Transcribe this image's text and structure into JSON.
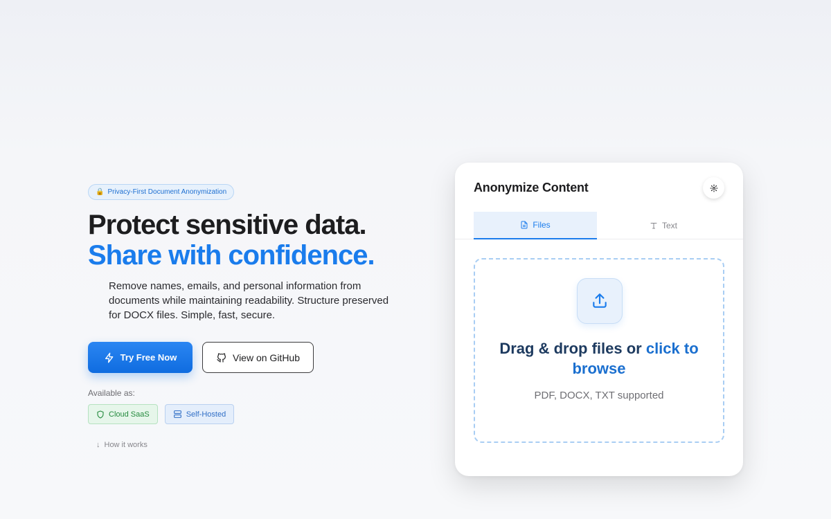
{
  "hero": {
    "badge_icon": "lock-icon",
    "badge_text": "Privacy-First Document Anonymization",
    "headline_line1": "Protect sensitive data.",
    "headline_line2": "Share with confidence.",
    "description": "Remove names, emails, and personal information from documents while maintaining readability. Structure preserved for DOCX files. Simple, fast, secure.",
    "primary_button": "Try Free Now",
    "secondary_button": "View on GitHub",
    "available_label": "Available as:",
    "chips": [
      {
        "label": "Cloud SaaS",
        "icon": "shield-icon"
      },
      {
        "label": "Self-Hosted",
        "icon": "server-icon"
      }
    ],
    "how_it_works": "How it works"
  },
  "card": {
    "title": "Anonymize Content",
    "tabs": [
      {
        "label": "Files",
        "icon": "file-icon",
        "active": true
      },
      {
        "label": "Text",
        "icon": "text-icon",
        "active": false
      }
    ],
    "dropzone": {
      "headline_part1": "Drag & drop files or ",
      "headline_part2": "click to browse",
      "supported": "PDF, DOCX, TXT supported"
    }
  },
  "colors": {
    "accent": "#1a7cec",
    "green_chip": "#248a3d",
    "blue_chip": "#2f6ec6"
  }
}
